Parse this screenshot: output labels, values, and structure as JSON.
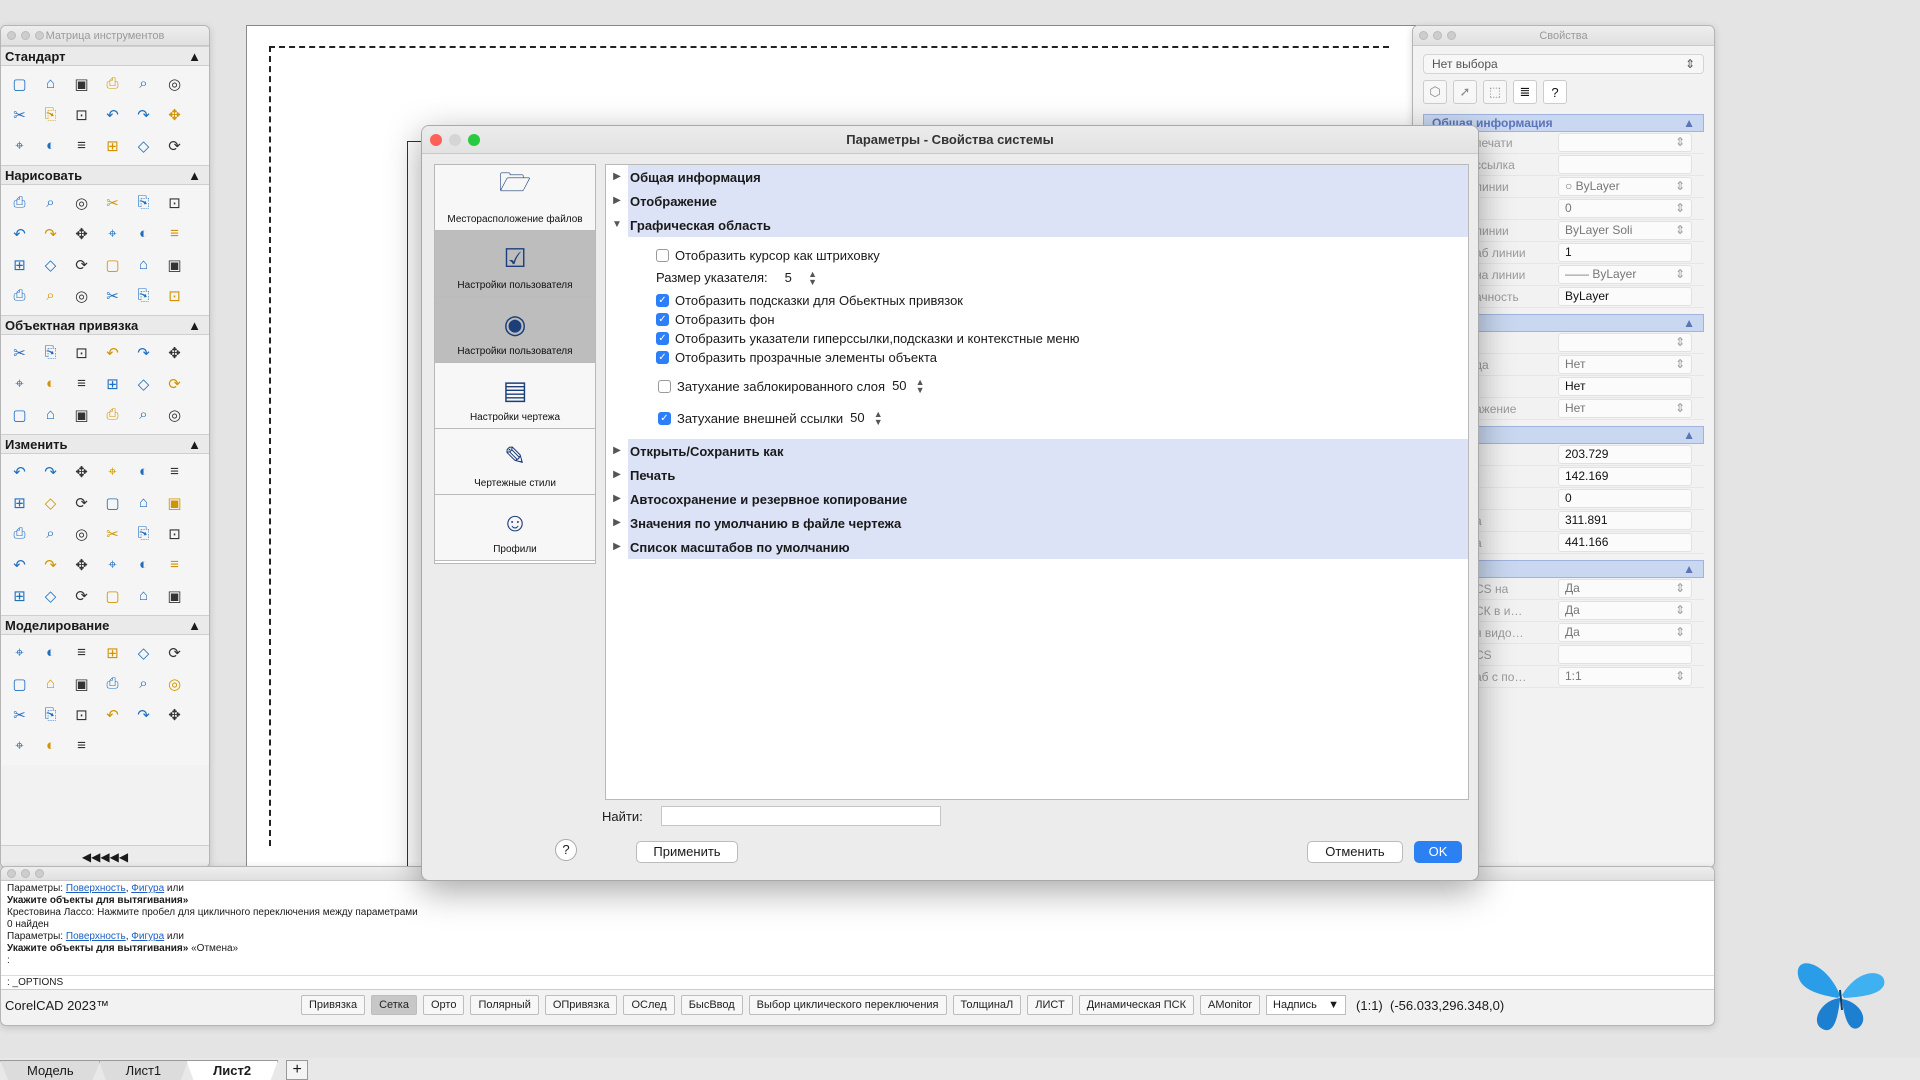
{
  "toolbox": {
    "title": "Матрица инструментов",
    "footer": "◀◀◀◀◀",
    "sections": [
      {
        "title": "Стандарт",
        "tools": [
          "new-file-icon",
          "open-folder-icon",
          "save-icon",
          "print-icon",
          "print-preview-icon",
          "zoom-preview-icon",
          "plot-icon",
          "cut-icon",
          "copy-icon",
          "paste-icon",
          "match-props-icon",
          "undo-icon",
          "redo-icon",
          "pan-icon",
          "zoom-window-icon",
          "zoom-realtime-icon",
          "layer-icon",
          "explorer-icon"
        ]
      },
      {
        "title": "Нарисовать",
        "tools": [
          "line-icon",
          "ray-icon",
          "circle-icon",
          "rectangle-icon",
          "polyline-icon",
          "spline-icon",
          "arc-icon",
          "ellipse-arc-icon",
          "helix-icon",
          "point-cloud-icon",
          "curve-icon",
          "polygon-icon",
          "construction-line-icon",
          "table-icon",
          "hatch-icon",
          "gradient-icon",
          "region-icon",
          "text-icon",
          "mtext-icon",
          "block-icon",
          "wipeout-icon",
          "revcloud-icon",
          "donut-icon",
          "image-icon"
        ]
      },
      {
        "title": "Объектная привязка",
        "tools": [
          "snap-endpoint-icon",
          "snap-midpoint-icon",
          "snap-intersection-icon",
          "snap-apparent-icon",
          "snap-extension-icon",
          "snap-perpendicular-icon",
          "snap-tangent-icon",
          "snap-center-icon",
          "snap-node-icon",
          "snap-quadrant-icon",
          "snap-insertion-icon",
          "snap-nearest-icon",
          "snap-parallel-icon",
          "snap-parallel2-icon",
          "snap-clear-icon",
          "snap-none-icon",
          "snap-settings-icon",
          "snap-toggle-icon"
        ]
      },
      {
        "title": "Изменить",
        "tools": [
          "erase-icon",
          "explode-icon",
          "copy-obj-icon",
          "mirror-icon",
          "offset-icon",
          "array-icon",
          "move-icon",
          "rotate-icon",
          "scale-icon",
          "stretch-icon",
          "lengthen-icon",
          "trim-icon",
          "extend-icon",
          "break-icon",
          "join-icon",
          "chamfer-icon",
          "fillet-icon",
          "blend-icon",
          "align-icon",
          "measure-icon",
          "divide-icon",
          "edit-polyline-icon",
          "edit-spline-icon",
          "edit-hatch-icon",
          "edit-text-icon",
          "edit-block-icon",
          "edit-attr-icon",
          "edit-table-icon",
          "edit-xref-icon",
          "edit-field-icon"
        ]
      },
      {
        "title": "Моделирование",
        "tools": [
          "box-icon",
          "cone-icon",
          "cylinder-icon",
          "pyramid-icon",
          "sphere-icon",
          "torus-icon",
          "wedge-icon",
          "extrude-icon",
          "revolve-icon",
          "loft-icon",
          "sweep-icon",
          "presspull-icon",
          "union-icon",
          "subtract-icon",
          "intersect-icon",
          "slice-icon",
          "section-icon",
          "interfere-icon",
          "thicken-icon",
          "imprint-icon",
          "shell-icon"
        ]
      }
    ]
  },
  "properties": {
    "title": "Свойства",
    "selection": "Нет выбора",
    "help_button": "?",
    "sections": [
      {
        "title": "Общая информация",
        "rows": [
          {
            "label": "…печати",
            "value": "",
            "select": true
          },
          {
            "label": "…ссылка",
            "value": "",
            "select": false
          },
          {
            "label": "…линии",
            "value": "○ ByLayer",
            "select": true
          },
          {
            "label": "",
            "value": "0",
            "select": true
          },
          {
            "label": "…линии",
            "value": "ByLayer    Soli",
            "select": true
          },
          {
            "label": "…аб линии",
            "value": "1",
            "select": false
          },
          {
            "label": "…на линии",
            "value": "—— ByLayer",
            "select": true
          },
          {
            "label": "…ачность",
            "value": "ByLayer",
            "select": false
          }
        ]
      },
      {
        "title": "…ечати",
        "rows": [
          {
            "label": "",
            "value": "",
            "select": true
          },
          {
            "label": "…да",
            "value": "Нет",
            "select": true
          },
          {
            "label": "",
            "value": "Нет",
            "select": false
          },
          {
            "label": "…ажение",
            "value": "Нет",
            "select": true
          }
        ]
      },
      {
        "title": "",
        "rows": [
          {
            "label": "X",
            "value": "203.729",
            "select": false
          },
          {
            "label": "Y",
            "value": "142.169",
            "select": false
          },
          {
            "label": "Z",
            "value": "0",
            "select": false
          },
          {
            "label": "…а",
            "value": "311.891",
            "select": false
          },
          {
            "label": "…а",
            "value": "441.166",
            "select": false
          }
        ]
      },
      {
        "title": "",
        "rows": [
          {
            "label": "…CS на",
            "value": "Да",
            "select": true
          },
          {
            "label": "…СК в и…",
            "value": "Да",
            "select": true
          },
          {
            "label": "…я видо…",
            "value": "Да",
            "select": true
          },
          {
            "label": "…CS",
            "value": "",
            "select": false
          },
          {
            "label": "…аб с по…",
            "value": "1:1",
            "select": true
          }
        ]
      }
    ]
  },
  "dialog": {
    "title": "Параметры - Свойства системы",
    "sidebar": [
      {
        "label": "Месторасположение файлов",
        "icon": "folder-icon",
        "selected": false
      },
      {
        "label": "Настройки пользователя",
        "icon": "checklist-icon",
        "selected": true
      },
      {
        "label": "Настройки пользователя",
        "icon": "user-settings-icon",
        "selected": true
      },
      {
        "label": "Настройки чертежа",
        "icon": "drawing-settings-icon",
        "selected": false
      },
      {
        "label": "Чертежные стили",
        "icon": "drawing-styles-icon",
        "selected": false
      },
      {
        "label": "Профили",
        "icon": "profiles-icon",
        "selected": false
      }
    ],
    "categories_top": [
      "Общая информация",
      "Отображение",
      "Графическая область"
    ],
    "graphics_options": {
      "opt1": {
        "label": "Отобразить курсор как штриховку",
        "checked": false
      },
      "pointer_size_label": "Размер указателя:",
      "pointer_size_value": "5",
      "opt2": {
        "label": "Отобразить подсказки для Обьектных привязок",
        "checked": true
      },
      "opt3": {
        "label": "Отобразить фон",
        "checked": true
      },
      "opt4": {
        "label": "Отобразить указатели гиперссылки,подсказки и контекстные меню",
        "checked": true
      },
      "opt5": {
        "label": "Отобразить прозрачные элементы объекта",
        "checked": true
      },
      "fade_locked": {
        "label": "Затухание заблокированного слоя",
        "checked": false,
        "value": "50"
      },
      "fade_xref": {
        "label": "Затухание внешней ссылки",
        "checked": true,
        "value": "50"
      }
    },
    "categories_bottom": [
      "Открыть/Сохранить как",
      "Печать",
      "Автосохранение и резервное копирование",
      "Значения по умолчанию в файле чертежа",
      "Список масштабов по умолчанию"
    ],
    "find_label": "Найти:",
    "help": "?",
    "apply": "Применить",
    "cancel": "Отменить",
    "ok": "OK"
  },
  "command": {
    "lines": {
      "l1_prefix": "Параметры: ",
      "l1_link1": "Поверхность",
      "l1_sep": ", ",
      "l1_link2": "Фигура",
      "l1_suffix": " или",
      "l2": "Укажите объекты для вытягивания»",
      "l3": "Крестовина Лассо: Нажмите пробел для цикличного переключения между параметрами",
      "l4": "0 найден",
      "l5_prefix": "Параметры: ",
      "l5_link1": "Поверхность",
      "l5_sep": ", ",
      "l5_link2": "Фигура",
      "l5_suffix": " или",
      "l6_bold": "Укажите объекты для вытягивания»",
      "l6_rest": " «Отмена»",
      "l7": ":"
    },
    "input": ": _OPTIONS"
  },
  "statusbar": {
    "app_name": "CorelCAD 2023™",
    "buttons": [
      {
        "label": "Привязка",
        "on": false
      },
      {
        "label": "Сетка",
        "on": true
      },
      {
        "label": "Орто",
        "on": false
      },
      {
        "label": "Полярный",
        "on": false
      },
      {
        "label": "ОПривязка",
        "on": false
      },
      {
        "label": "ОСлед",
        "on": false
      },
      {
        "label": "БысВвод",
        "on": false
      },
      {
        "label": "Выбор циклического переключения",
        "on": false
      },
      {
        "label": "ТолщинаЛ",
        "on": false
      },
      {
        "label": "ЛИСТ",
        "on": false
      },
      {
        "label": "Динамическая ПСК",
        "on": false
      },
      {
        "label": "AMonitor",
        "on": false
      }
    ],
    "annotation": "Надпись",
    "scale": "(1:1)",
    "coords": "(-56.033,296.348,0)"
  },
  "tabs": [
    "Модель",
    "Лист1",
    "Лист2"
  ],
  "active_tab": "Лист2"
}
